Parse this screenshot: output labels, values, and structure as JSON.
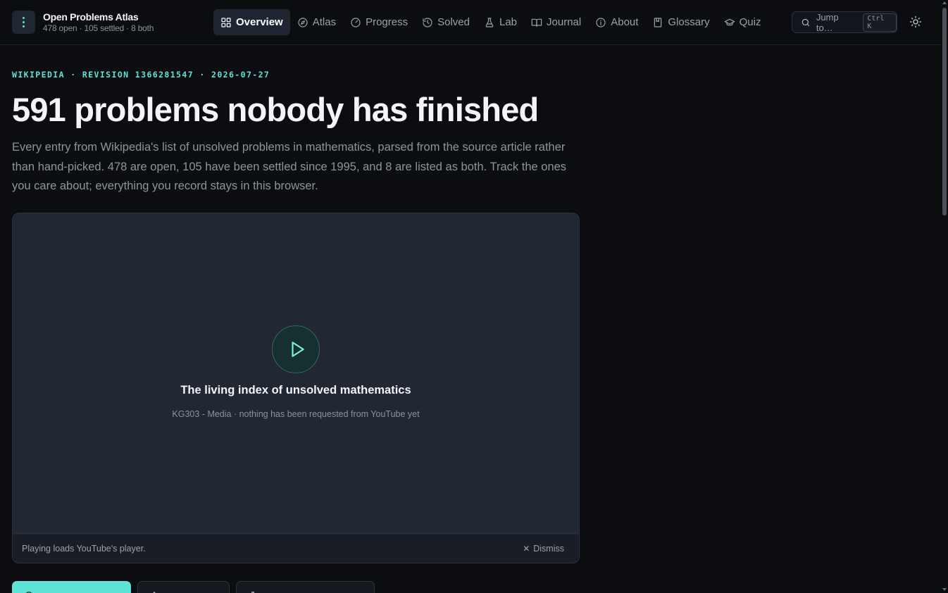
{
  "app": {
    "title": "Open Problems Atlas",
    "subtitle": "478 open · 105 settled · 8 both"
  },
  "nav": {
    "items": [
      {
        "label": "Overview",
        "icon": "grid-icon",
        "active": true
      },
      {
        "label": "Atlas",
        "icon": "compass-icon",
        "active": false
      },
      {
        "label": "Progress",
        "icon": "gauge-icon",
        "active": false
      },
      {
        "label": "Solved",
        "icon": "history-icon",
        "active": false
      },
      {
        "label": "Lab",
        "icon": "flask-icon",
        "active": false
      },
      {
        "label": "Journal",
        "icon": "book-open-icon",
        "active": false
      },
      {
        "label": "About",
        "icon": "info-icon",
        "active": false
      },
      {
        "label": "Glossary",
        "icon": "book-icon",
        "active": false
      },
      {
        "label": "Quiz",
        "icon": "graduation-cap-icon",
        "active": false
      }
    ]
  },
  "search": {
    "label": "Jump to…",
    "shortcut": "Ctrl K"
  },
  "hero": {
    "eyebrow": "WIKIPEDIA · REVISION 1366281547 · 2026-07-27",
    "title": "591 problems nobody has finished",
    "intro": "Every entry from Wikipedia's list of unsolved problems in mathematics, parsed from the source article rather than hand-picked. 478 are open, 105 have been settled since 1995, and 8 are listed as both. Track the ones you care about; everything you record stays in this browser."
  },
  "video": {
    "title": "The living index of unsolved mathematics",
    "subtitle": "KG303 - Media · nothing has been requested from YouTube yet",
    "footer_note": "Playing loads YouTube's player.",
    "dismiss_label": "Dismiss"
  },
  "colors": {
    "background": "#0b0d11",
    "accent": "#5de4d6",
    "panel": "#222833"
  }
}
